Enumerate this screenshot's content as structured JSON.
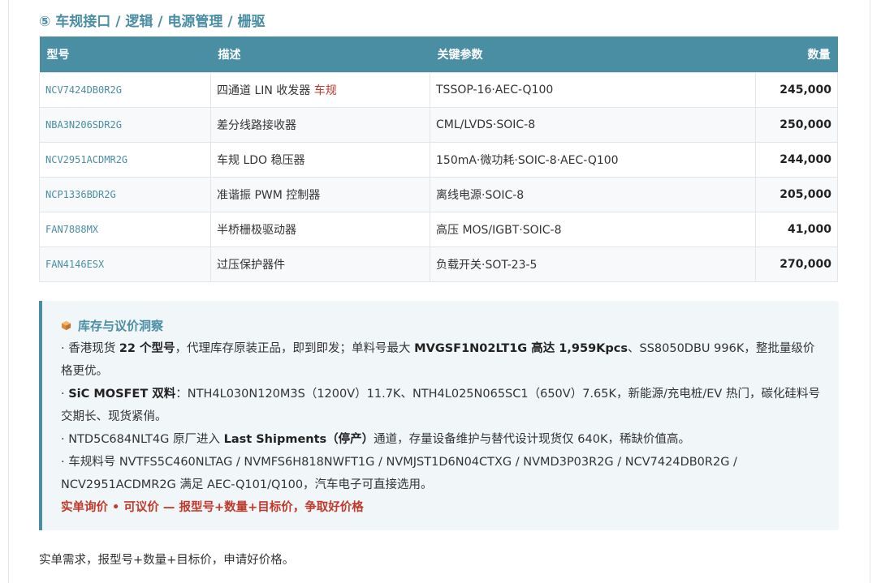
{
  "section": {
    "title": "⑤ 车规接口 / 逻辑 / 电源管理 / 栅驱"
  },
  "table": {
    "headers": {
      "model": "型号",
      "desc": "描述",
      "params": "关键参数",
      "qty": "数量"
    },
    "rows": [
      {
        "model": "NCV7424DB0R2G",
        "desc": "四通道 LIN 收发器 ",
        "tag": "车规",
        "params": "TSSOP-16·AEC-Q100",
        "qty": "245,000"
      },
      {
        "model": "NBA3N206SDR2G",
        "desc": "差分线路接收器",
        "tag": "",
        "params": "CML/LVDS·SOIC-8",
        "qty": "250,000"
      },
      {
        "model": "NCV2951ACDMR2G",
        "desc": "车规 LDO 稳压器",
        "tag": "",
        "params": "150mA·微功耗·SOIC-8·AEC-Q100",
        "qty": "244,000"
      },
      {
        "model": "NCP1336BDR2G",
        "desc": "准谐振 PWM 控制器",
        "tag": "",
        "params": "离线电源·SOIC-8",
        "qty": "205,000"
      },
      {
        "model": "FAN7888MX",
        "desc": "半桥栅极驱动器",
        "tag": "",
        "params": "高压 MOS/IGBT·SOIC-8",
        "qty": "41,000"
      },
      {
        "model": "FAN4146ESX",
        "desc": "过压保护器件",
        "tag": "",
        "params": "负载开关·SOT-23-5",
        "qty": "270,000"
      }
    ]
  },
  "insight": {
    "icon": "package-icon",
    "title": "库存与议价洞察",
    "p1": {
      "a": "· 香港现货 ",
      "b": "22 个型号",
      "c": "，代理库存原装正品，即到即发；单料号最大 ",
      "d": "MVGSF1N02LT1G 高达 1,959Kpcs",
      "e": "、SS8050DBU 996K，整批量级价格更优。"
    },
    "p2": {
      "a": "· ",
      "b": "SiC MOSFET 双料",
      "c": "：NTH4L030N120M3S（1200V）11.7K、NTH4L025N065SC1（650V）7.65K，新能源/充电桩/EV 热门，碳化硅料号交期长、现货紧俏。"
    },
    "p3": {
      "a": "· NTD5C684NLT4G 原厂进入 ",
      "b": "Last Shipments（停产）",
      "c": "通道，存量设备维护与替代设计现货仅 640K，稀缺价值高。"
    },
    "p4": "· 车规料号 NVTFS5C460NLTAG / NVMFS6H818NWFT1G / NVMJST1D6N04CTXG / NVMD3P03R2G / NCV7424DB0R2G / NCV2951ACDMR2G 满足 AEC-Q101/Q100，汽车电子可直接选用。",
    "cta": "实单询价 • 可议价 — 报型号+数量+目标价，争取好价格"
  },
  "footer": {
    "text": "实单需求，报型号+数量+目标价，申请好价格。"
  },
  "colors": {
    "accent": "#4a8ea4",
    "highlight": "#c0392b",
    "panel_bg": "#f1f6f8"
  }
}
